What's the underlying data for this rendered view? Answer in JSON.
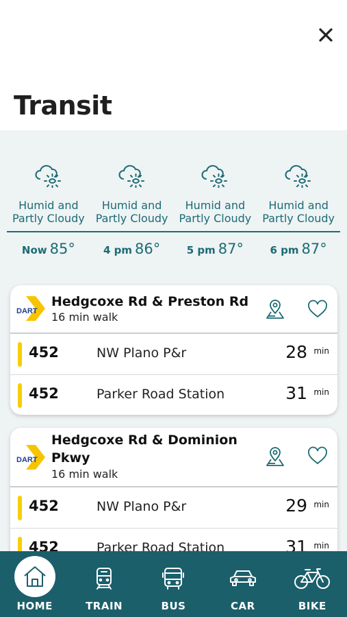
{
  "page": {
    "title": "Transit"
  },
  "colors": {
    "accent": "#1c6b74",
    "nav_bg": "#1b5f6b",
    "route_bar": "#f7cf00",
    "dart_yellow": "#f7c400",
    "dart_blue": "#1d3f8f"
  },
  "weather": [
    {
      "condition": "Humid and Partly Cloudy",
      "time": "Now",
      "temp": "85°"
    },
    {
      "condition": "Humid and Partly Cloudy",
      "time": "4 pm",
      "temp": "86°"
    },
    {
      "condition": "Humid and Partly Cloudy",
      "time": "5 pm",
      "temp": "87°"
    },
    {
      "condition": "Humid and Partly Cloudy",
      "time": "6 pm",
      "temp": "87°"
    }
  ],
  "stops": [
    {
      "agency": "DART",
      "name": "Hedgcoxe Rd & Preston Rd",
      "walk": "16 min walk",
      "routes": [
        {
          "number": "452",
          "destination": "NW Plano P&r",
          "eta": "28",
          "unit": "min"
        },
        {
          "number": "452",
          "destination": "Parker Road Station",
          "eta": "31",
          "unit": "min"
        }
      ]
    },
    {
      "agency": "DART",
      "name": "Hedgcoxe Rd & Dominion Pkwy",
      "walk": "16 min walk",
      "routes": [
        {
          "number": "452",
          "destination": "NW Plano P&r",
          "eta": "29",
          "unit": "min"
        },
        {
          "number": "452",
          "destination": "Parker Road Station",
          "eta": "31",
          "unit": "min"
        }
      ]
    }
  ],
  "nav": [
    {
      "label": "HOME",
      "icon": "home-icon",
      "active": true
    },
    {
      "label": "TRAIN",
      "icon": "train-icon",
      "active": false
    },
    {
      "label": "BUS",
      "icon": "bus-icon",
      "active": false
    },
    {
      "label": "CAR",
      "icon": "car-icon",
      "active": false
    },
    {
      "label": "BIKE",
      "icon": "bike-icon",
      "active": false
    }
  ]
}
